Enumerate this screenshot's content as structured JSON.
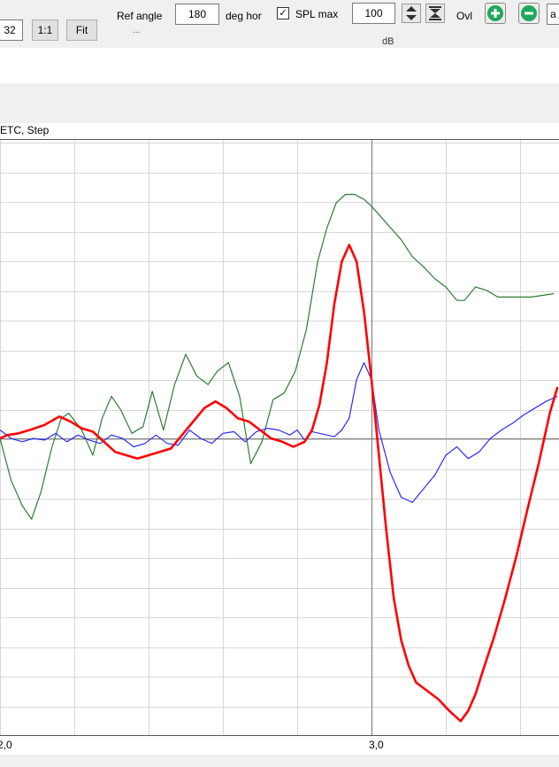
{
  "toolbar": {
    "zoom_value": "32",
    "one_to_one_label": "1:1",
    "fit_label": "Fit",
    "ref_angle_label": "Ref angle",
    "ref_angle_value": "180",
    "deg_hor_label": "deg hor",
    "spl_max_checked": true,
    "spl_max_check_glyph": "✓",
    "spl_max_label": "SPL max",
    "spl_max_value": "100",
    "ovl_label": "Ovl",
    "add_icon": "plus-icon",
    "remove_icon": "minus-icon",
    "clipped_field_value": "a",
    "ellipsis_text": "...",
    "db_label": "dB"
  },
  "chart": {
    "title": "ETC, Step",
    "colors": {
      "green": "#2e7d32",
      "blue": "#2b2bff",
      "red": "#ff0000",
      "grid": "#d8d8d8",
      "axis": "#777777"
    }
  },
  "chart_data": {
    "type": "line",
    "title": "ETC, Step",
    "xlabel": "",
    "ylabel": "",
    "xlim": [
      2.0,
      3.5
    ],
    "x_ticks": [
      "2,0",
      "3,0"
    ],
    "grid": true,
    "series": [
      {
        "color": "#2e7d32",
        "x": [
          2.0,
          2.03,
          2.06,
          2.085,
          2.11,
          2.14,
          2.165,
          2.185,
          2.22,
          2.25,
          2.275,
          2.3,
          2.325,
          2.355,
          2.385,
          2.41,
          2.44,
          2.47,
          2.5,
          2.53,
          2.56,
          2.585,
          2.615,
          2.645,
          2.675,
          2.705,
          2.735,
          2.765,
          2.795,
          2.825,
          2.855,
          2.88,
          2.905,
          2.93,
          2.955,
          2.98,
          3.0,
          3.04,
          3.08,
          3.11,
          3.14,
          3.17,
          3.2,
          3.23,
          3.25,
          3.28,
          3.31,
          3.34,
          3.37,
          3.4,
          3.43,
          3.46,
          3.49
        ],
        "y": [
          0.0,
          -0.25,
          -0.4,
          -0.48,
          -0.32,
          -0.05,
          0.12,
          0.15,
          0.05,
          -0.1,
          0.12,
          0.25,
          0.17,
          0.03,
          0.07,
          0.28,
          0.05,
          0.32,
          0.5,
          0.37,
          0.32,
          0.4,
          0.45,
          0.25,
          -0.15,
          -0.02,
          0.23,
          0.27,
          0.4,
          0.65,
          1.05,
          1.25,
          1.4,
          1.45,
          1.45,
          1.42,
          1.38,
          1.28,
          1.18,
          1.08,
          1.02,
          0.95,
          0.9,
          0.82,
          0.82,
          0.9,
          0.88,
          0.84,
          0.84,
          0.84,
          0.84,
          0.85,
          0.86
        ]
      },
      {
        "color": "#2b2bff",
        "x": [
          2.0,
          2.03,
          2.06,
          2.09,
          2.12,
          2.15,
          2.18,
          2.21,
          2.24,
          2.27,
          2.3,
          2.33,
          2.36,
          2.39,
          2.42,
          2.45,
          2.48,
          2.51,
          2.54,
          2.57,
          2.6,
          2.63,
          2.66,
          2.69,
          2.72,
          2.75,
          2.78,
          2.8,
          2.82,
          2.84,
          2.86,
          2.88,
          2.9,
          2.92,
          2.94,
          2.96,
          2.98,
          3.0,
          3.02,
          3.05,
          3.08,
          3.11,
          3.14,
          3.17,
          3.2,
          3.23,
          3.26,
          3.29,
          3.32,
          3.35,
          3.38,
          3.41,
          3.44,
          3.47,
          3.5
        ],
        "y": [
          0.05,
          0.0,
          -0.02,
          0.0,
          -0.01,
          0.03,
          -0.02,
          0.02,
          -0.01,
          -0.03,
          0.02,
          0.0,
          -0.05,
          -0.03,
          0.02,
          -0.03,
          -0.04,
          0.05,
          0.0,
          -0.03,
          0.03,
          0.04,
          -0.02,
          0.04,
          0.06,
          0.05,
          0.02,
          0.05,
          -0.01,
          0.04,
          0.03,
          0.02,
          0.01,
          0.05,
          0.12,
          0.35,
          0.45,
          0.35,
          0.05,
          -0.2,
          -0.35,
          -0.38,
          -0.3,
          -0.22,
          -0.1,
          -0.05,
          -0.12,
          -0.08,
          0.0,
          0.05,
          0.09,
          0.14,
          0.18,
          0.22,
          0.25
        ]
      },
      {
        "color": "#ff0000",
        "x": [
          2.0,
          2.02,
          2.05,
          2.08,
          2.12,
          2.16,
          2.19,
          2.22,
          2.25,
          2.28,
          2.31,
          2.34,
          2.37,
          2.4,
          2.43,
          2.46,
          2.49,
          2.52,
          2.55,
          2.58,
          2.61,
          2.64,
          2.67,
          2.7,
          2.73,
          2.76,
          2.79,
          2.82,
          2.84,
          2.86,
          2.88,
          2.9,
          2.92,
          2.94,
          2.96,
          2.98,
          3.0,
          3.02,
          3.04,
          3.06,
          3.08,
          3.1,
          3.12,
          3.15,
          3.18,
          3.21,
          3.24,
          3.26,
          3.28,
          3.3,
          3.33,
          3.36,
          3.39,
          3.42,
          3.45,
          3.48,
          3.5
        ],
        "y": [
          0.0,
          0.02,
          0.03,
          0.05,
          0.08,
          0.13,
          0.1,
          0.06,
          0.04,
          -0.02,
          -0.08,
          -0.1,
          -0.12,
          -0.1,
          -0.08,
          -0.06,
          0.02,
          0.1,
          0.18,
          0.22,
          0.18,
          0.12,
          0.1,
          0.05,
          0.0,
          -0.02,
          -0.05,
          -0.02,
          0.05,
          0.2,
          0.45,
          0.8,
          1.05,
          1.15,
          1.05,
          0.75,
          0.35,
          -0.1,
          -0.55,
          -0.95,
          -1.2,
          -1.35,
          -1.45,
          -1.5,
          -1.55,
          -1.62,
          -1.68,
          -1.62,
          -1.52,
          -1.38,
          -1.18,
          -0.95,
          -0.7,
          -0.42,
          -0.15,
          0.15,
          0.3
        ]
      }
    ]
  }
}
